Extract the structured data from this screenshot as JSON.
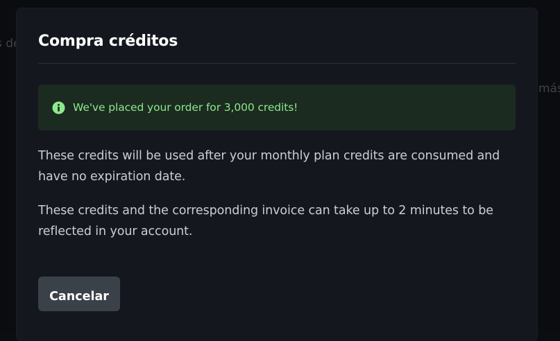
{
  "background": {
    "left_text": "s de",
    "right_text": "más p"
  },
  "modal": {
    "title": "Compra créditos",
    "alert": {
      "icon": "info-circle-icon",
      "text": "We've placed your order for 3,000 credits!",
      "color": "#8fe78e",
      "background": "#1b2b20"
    },
    "paragraphs": [
      "These credits will be used after your monthly plan credits are consumed and have no expiration date.",
      "These credits and the corresponding invoice can take up to 2 minutes to be reflected in your account."
    ],
    "cancel_label": "Cancelar"
  }
}
